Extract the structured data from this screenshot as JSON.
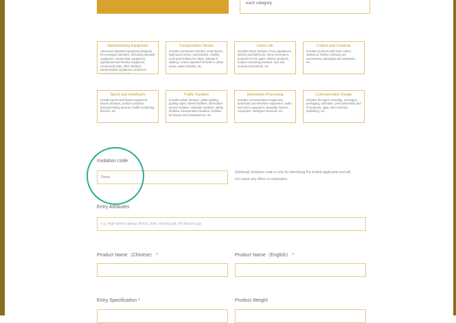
{
  "top": {
    "card_text": "each category."
  },
  "categories": [
    {
      "title": "Manufacturing Equipment",
      "desc": "Advanced industrial equipment designed for emerging industries, including industrial equipment, construction equipment, agricultural and forestry equipment, mechanical tools, office facilities, transportation equipment, protection equipment, industrial kit."
    },
    {
      "title": "Transportation Means",
      "desc": "Includes unmanned vehicles, smart buses, high-speed trains, automobiles, mobility tools and facilities for riding, instead of walking, vendor operated vehicles in urban areas, water vehicles, etc."
    },
    {
      "title": "Home Life",
      "desc": "Includes home furniture, home appliances, kitchen and bathroom, home decoration, products for the aged, children products, outdoor and living products, toys and musical instruments, etc."
    },
    {
      "title": "Culture and Creativity",
      "desc": "Includes products with local culture, stationery, fashion clothing and accessories, packaging and tableware, etc."
    },
    {
      "title": "Sports and Healthcare",
      "desc": "Include sports and fitness equipment, leisure products, outdoor products, physical testing devices, health monitoring devices, etc."
    },
    {
      "title": "Public Facilities",
      "desc": "Includes urban furniture, public lighting, guiding signs, shared facilities, information service facilities, sanitation facilities, safety facilities, transportation facilities, facilities for leisure and entertainment, etc."
    },
    {
      "title": "Information Processing",
      "desc": "Includes communication equipment, broadcast and television equipment, audio and video equipment, wearable devices, computers, intelligent terminals, etc."
    },
    {
      "title": "Communication Design",
      "desc": "Includes the logos, branding, messages, packaging, animation, print advertising and IP products, apps, user interface, publishing, etc."
    }
  ],
  "form": {
    "invitation_label": "Invitation code",
    "invitation_value": "Desai",
    "invitation_note_1": "(Optional) Invitation code is only for identifying the invited applicants and will",
    "invitation_note_2": "not cause any effect on evaluation.",
    "attributes_label": "Entry Attributes",
    "attributes_placeholder": "e.g. High-speed railway, Robot, Sofa, Hearing aid, KR Brand Logo",
    "product_cn_label": "Product Name（Chinese）",
    "product_en_label": "Product Name（English）",
    "required_mark": "*",
    "spec_label": "Entry Specification",
    "weight_label": "Product Weight"
  },
  "colors": {
    "accent_gold": "#d9a22c",
    "border_gold": "#e6c98a",
    "highlight_circle": "#2bab91",
    "frame": "#8a6d1d"
  }
}
